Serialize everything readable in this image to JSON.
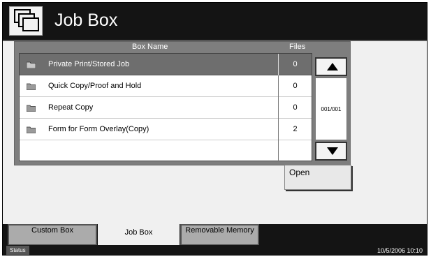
{
  "header": {
    "title": "Job Box",
    "icon": "stacked-windows-icon"
  },
  "list": {
    "columns": {
      "name": "Box Name",
      "files": "Files"
    },
    "rows": [
      {
        "name": "Private Print/Stored Job",
        "files": "0",
        "selected": true
      },
      {
        "name": "Quick Copy/Proof and Hold",
        "files": "0"
      },
      {
        "name": "Repeat Copy",
        "files": "0"
      },
      {
        "name": "Form for Form Overlay(Copy)",
        "files": "2"
      },
      {
        "name": "",
        "files": ""
      }
    ],
    "page": "001/001"
  },
  "actions": {
    "open_label": "Open"
  },
  "tabs": [
    {
      "label": "Custom Box",
      "active": false
    },
    {
      "label": "Job Box",
      "active": true
    },
    {
      "label": "Removable Memory",
      "active": false
    }
  ],
  "status": {
    "label": "Status",
    "datetime": "10/5/2006   10:10"
  }
}
